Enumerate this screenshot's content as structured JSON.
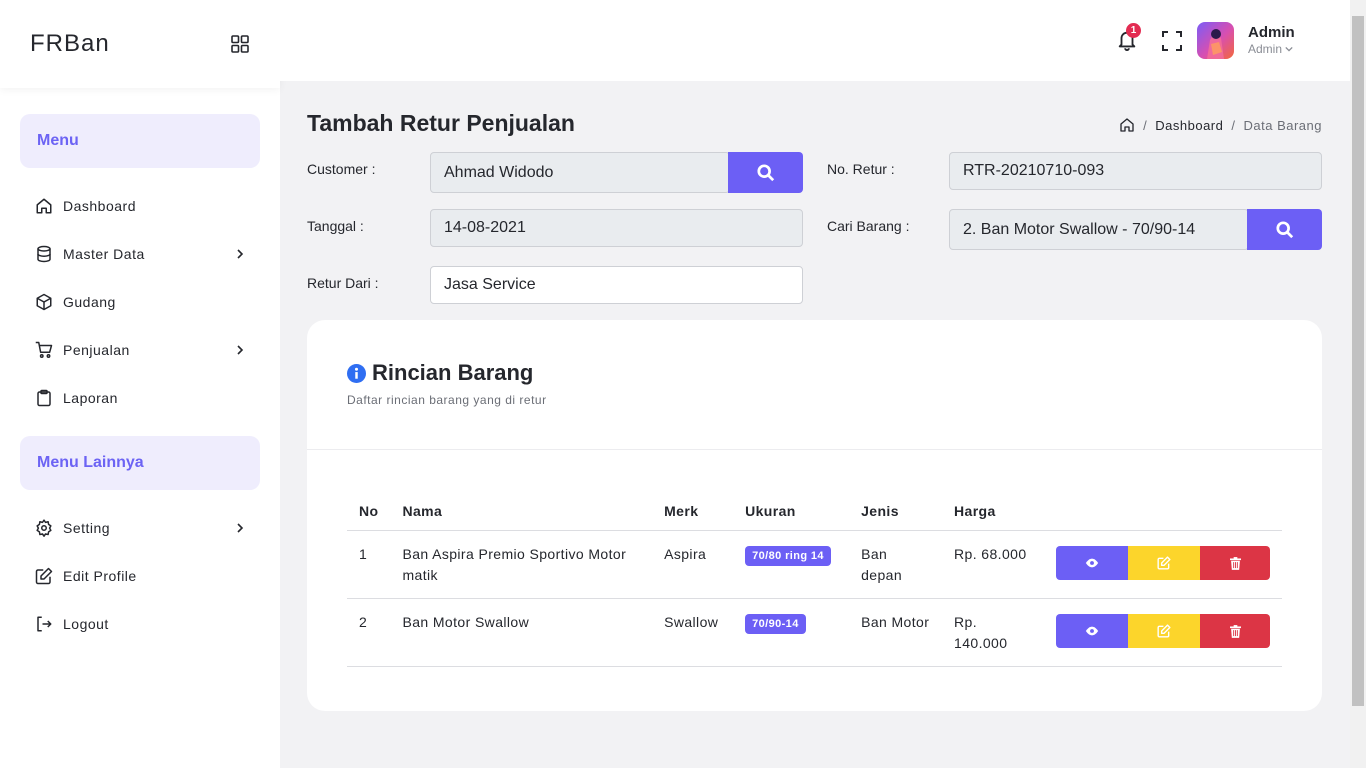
{
  "brand": {
    "name": "FRBan"
  },
  "sidebar": {
    "menu_header": "Menu",
    "items": [
      {
        "label": "Dashboard",
        "icon": "home-icon",
        "has_submenu": false
      },
      {
        "label": "Master Data",
        "icon": "database-icon",
        "has_submenu": true
      },
      {
        "label": "Gudang",
        "icon": "box-icon",
        "has_submenu": false
      },
      {
        "label": "Penjualan",
        "icon": "cart-icon",
        "has_submenu": true
      },
      {
        "label": "Laporan",
        "icon": "clipboard-icon",
        "has_submenu": false
      }
    ],
    "other_header": "Menu Lainnya",
    "other_items": [
      {
        "label": "Setting",
        "icon": "gear-icon",
        "has_submenu": true
      },
      {
        "label": "Edit Profile",
        "icon": "edit-icon",
        "has_submenu": false
      },
      {
        "label": "Logout",
        "icon": "logout-icon",
        "has_submenu": false
      }
    ]
  },
  "topbar": {
    "notification_count": "1",
    "user_name": "Admin",
    "user_role": "Admin"
  },
  "page": {
    "title": "Tambah Retur Penjualan",
    "breadcrumb": [
      "Dashboard",
      "Data Barang"
    ]
  },
  "form": {
    "customer_label": "Customer :",
    "customer_value": "Ahmad Widodo",
    "tanggal_label": "Tanggal :",
    "tanggal_value": "14-08-2021",
    "retur_dari_label": "Retur Dari :",
    "retur_dari_value": "Jasa Service",
    "no_retur_label": "No. Retur :",
    "no_retur_value": "RTR-20210710-093",
    "cari_barang_label": "Cari Barang :",
    "cari_barang_value": "2. Ban Motor Swallow - 70/90-14"
  },
  "card": {
    "title": "Rincian Barang",
    "subtitle": "Daftar rincian barang yang di retur",
    "columns": [
      "No",
      "Nama",
      "Merk",
      "Ukuran",
      "Jenis",
      "Harga"
    ],
    "rows": [
      {
        "no": "1",
        "nama": "Ban Aspira Premio Sportivo Motor matik",
        "merk": "Aspira",
        "ukuran": "70/80 ring 14",
        "jenis": "Ban depan",
        "harga": "Rp. 68.000"
      },
      {
        "no": "2",
        "nama": "Ban Motor Swallow",
        "merk": "Swallow",
        "ukuran": "70/90-14",
        "jenis": "Ban Motor",
        "harga": "Rp. 140.000"
      }
    ]
  },
  "colors": {
    "primary": "#6c5ff5",
    "warning": "#fcd52b",
    "danger": "#dc3545",
    "menu_header_bg": "#efedfd",
    "badge_notification": "#e32c52"
  }
}
